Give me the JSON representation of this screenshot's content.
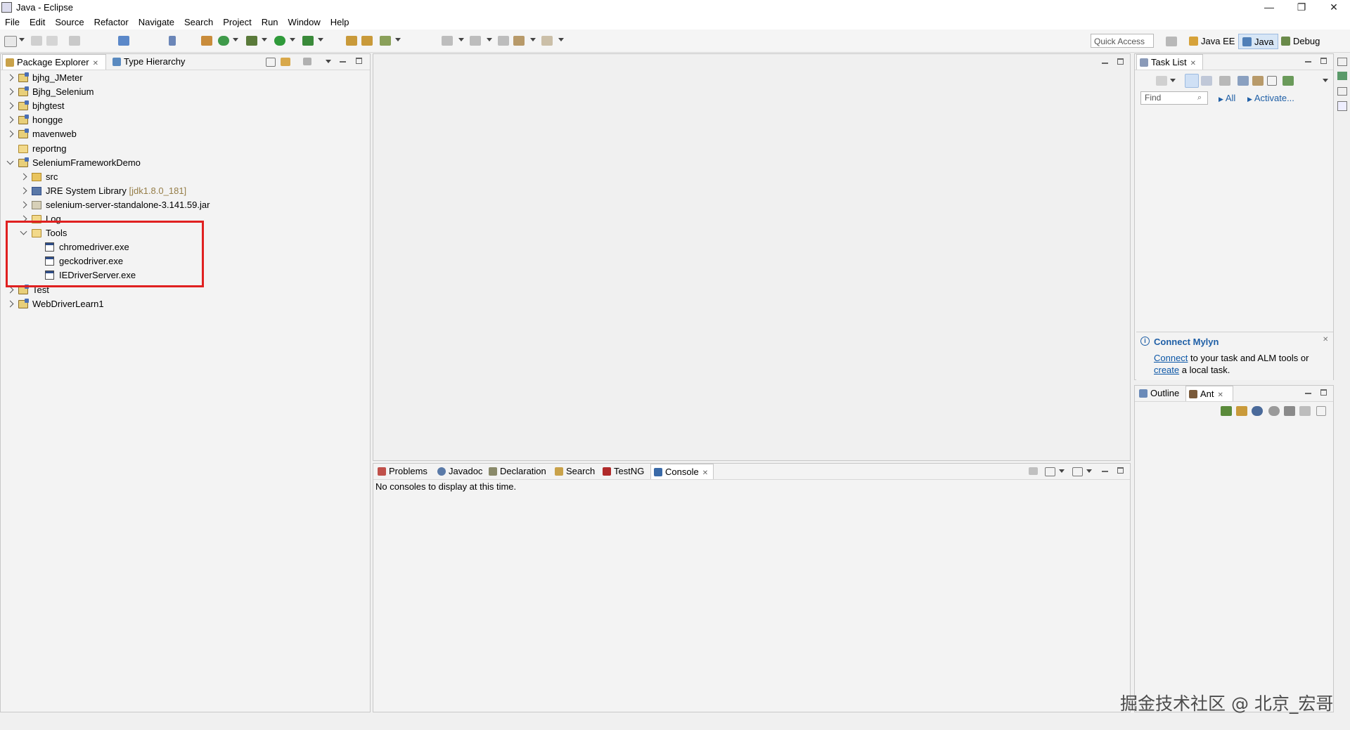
{
  "window": {
    "title": "Java - Eclipse",
    "controls": {
      "minimize": "—",
      "restore": "❐",
      "close": "✕"
    }
  },
  "menu": [
    "File",
    "Edit",
    "Source",
    "Refactor",
    "Navigate",
    "Search",
    "Project",
    "Run",
    "Window",
    "Help"
  ],
  "toolbar": {
    "quick_access_placeholder": "Quick Access",
    "perspectives": [
      "Java EE",
      "Java",
      "Debug"
    ],
    "active_perspective": "Java"
  },
  "package_explorer": {
    "tabs": [
      "Package Explorer",
      "Type Hierarchy"
    ],
    "tree": [
      {
        "label": "bjhg_JMeter",
        "depth": 0,
        "state": "closed",
        "icon": "project"
      },
      {
        "label": "Bjhg_Selenium",
        "depth": 0,
        "state": "closed",
        "icon": "project"
      },
      {
        "label": "bjhgtest",
        "depth": 0,
        "state": "closed",
        "icon": "project"
      },
      {
        "label": "hongge",
        "depth": 0,
        "state": "closed",
        "icon": "project"
      },
      {
        "label": "mavenweb",
        "depth": 0,
        "state": "closed",
        "icon": "project"
      },
      {
        "label": "reportng",
        "depth": 0,
        "state": "none",
        "icon": "folder"
      },
      {
        "label": "SeleniumFrameworkDemo",
        "depth": 0,
        "state": "open",
        "icon": "project"
      },
      {
        "label": "src",
        "depth": 1,
        "state": "closed",
        "icon": "pkgfolder"
      },
      {
        "label": "JRE System Library",
        "suffix": "[jdk1.8.0_181]",
        "depth": 1,
        "state": "closed",
        "icon": "lib"
      },
      {
        "label": "selenium-server-standalone-3.141.59.jar",
        "depth": 1,
        "state": "closed",
        "icon": "jar"
      },
      {
        "label": "Log",
        "depth": 1,
        "state": "closed",
        "icon": "folder"
      },
      {
        "label": "Tools",
        "depth": 1,
        "state": "open",
        "icon": "folder"
      },
      {
        "label": "chromedriver.exe",
        "depth": 2,
        "state": "none",
        "icon": "exe"
      },
      {
        "label": "geckodriver.exe",
        "depth": 2,
        "state": "none",
        "icon": "exe"
      },
      {
        "label": "IEDriverServer.exe",
        "depth": 2,
        "state": "none",
        "icon": "exe"
      },
      {
        "label": "Test",
        "depth": 0,
        "state": "closed",
        "icon": "project"
      },
      {
        "label": "WebDriverLearn1",
        "depth": 0,
        "state": "closed",
        "icon": "project"
      }
    ]
  },
  "console": {
    "tabs": [
      "Problems",
      "Javadoc",
      "Declaration",
      "Search",
      "TestNG",
      "Console"
    ],
    "active_tab": "Console",
    "message": "No consoles to display at this time."
  },
  "task_list": {
    "tab": "Task List",
    "find_placeholder": "Find",
    "filter_all": "All",
    "activate": "Activate..."
  },
  "mylyn": {
    "title": "Connect Mylyn",
    "connect_link": "Connect",
    "text_middle": " to your task and ALM tools or",
    "create_link": "create",
    "text_end": " a local task."
  },
  "outline": {
    "tabs": [
      "Outline",
      "Ant"
    ]
  },
  "watermark": "掘金技术社区 @ 北京_宏哥",
  "colors": {
    "highlight": "#e02020",
    "link": "#0b56a6",
    "mylyn_title": "#1f5fa6",
    "library_version": "#957d47"
  }
}
